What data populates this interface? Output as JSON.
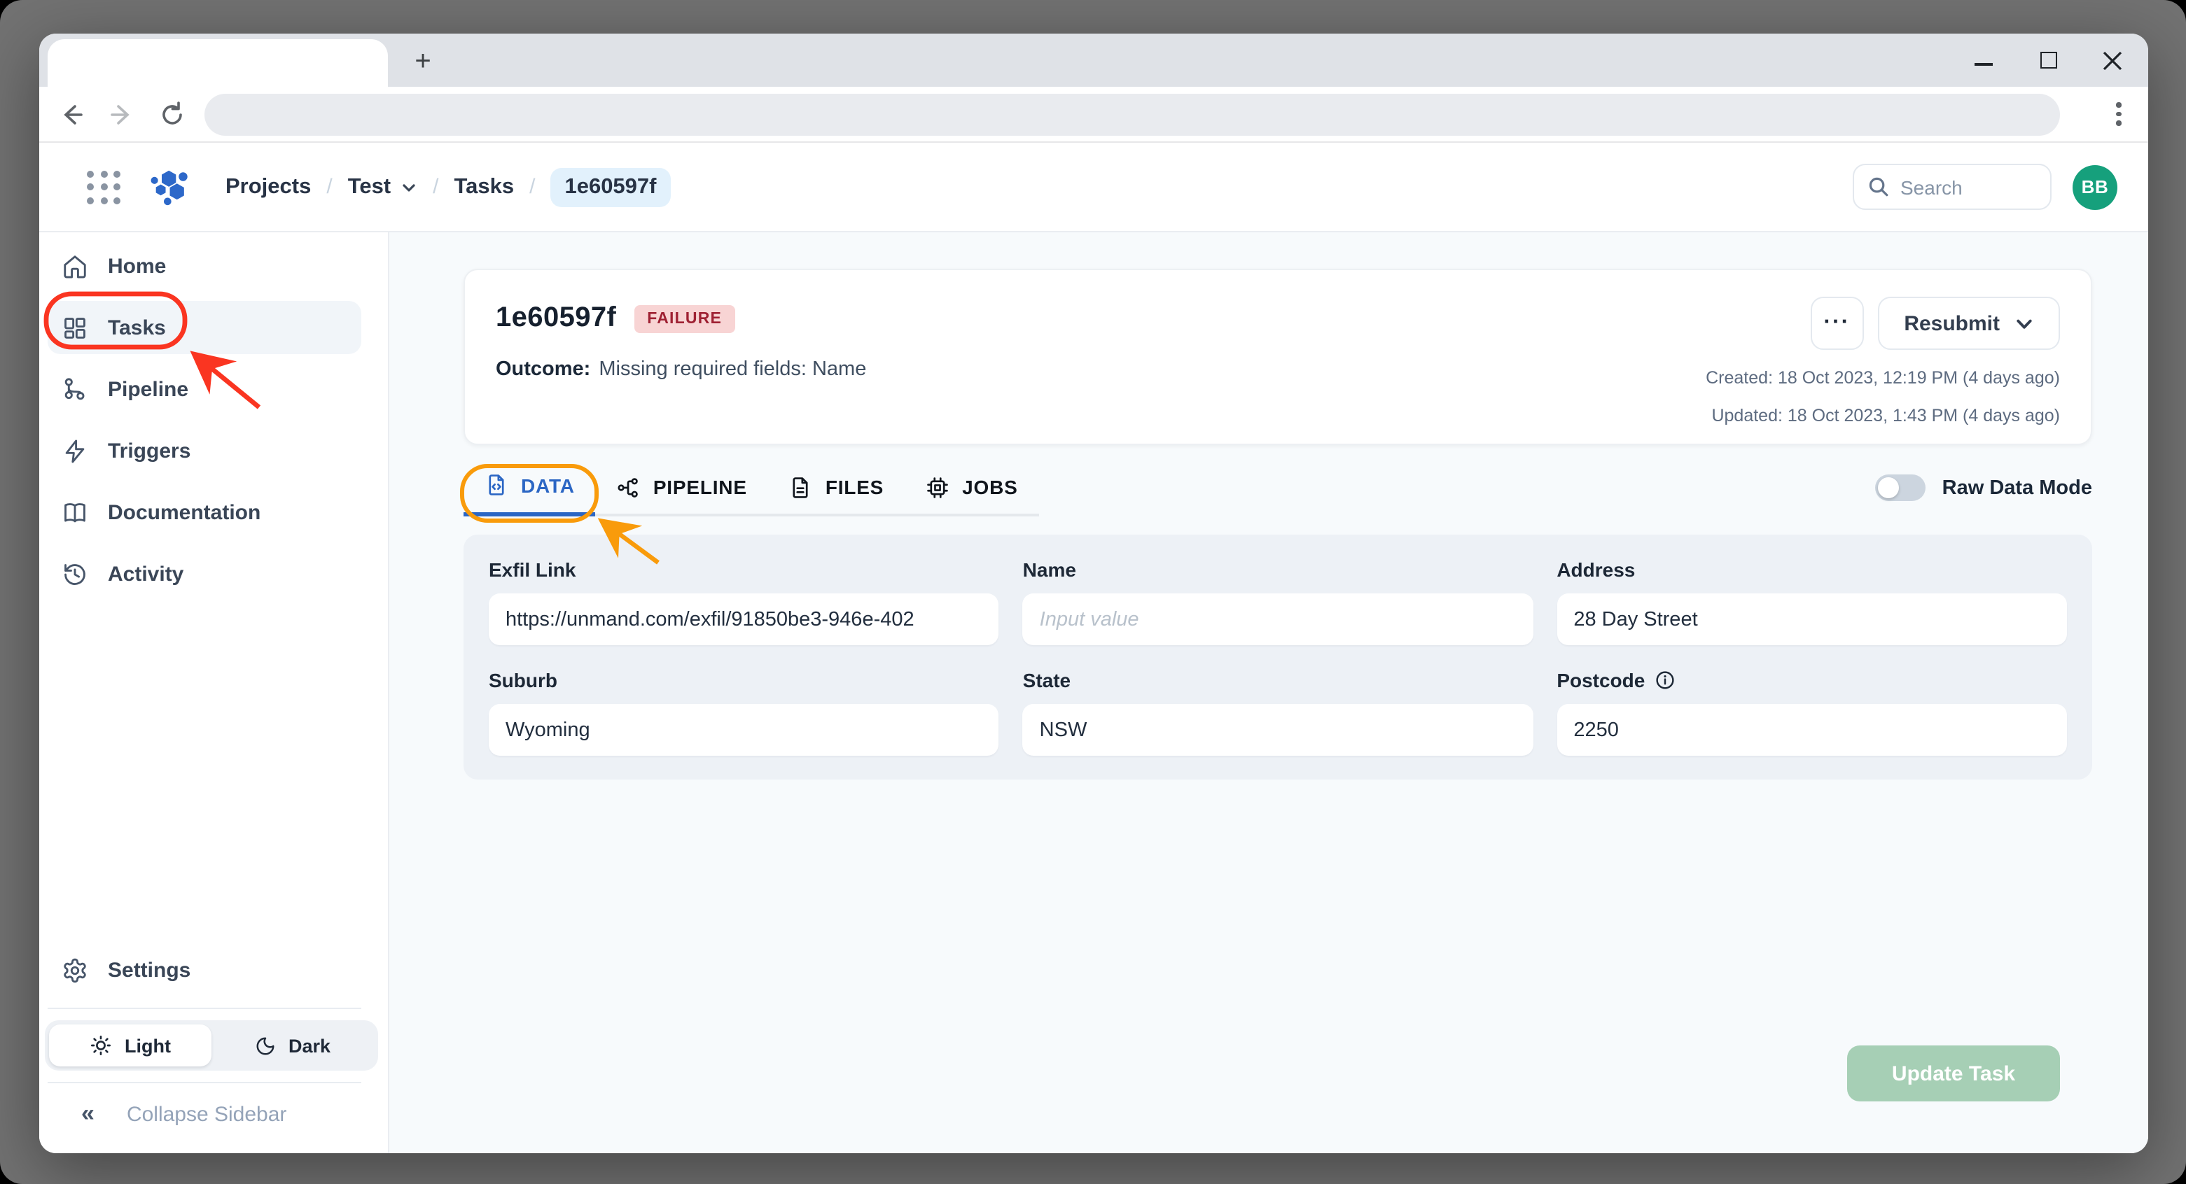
{
  "browser": {
    "new_tab_label": "+",
    "url_value": ""
  },
  "header": {
    "breadcrumbs": {
      "projects": "Projects",
      "project": "Test",
      "section": "Tasks",
      "task_id": "1e60597f"
    },
    "separator": "/",
    "search_placeholder": "Search",
    "avatar_initials": "BB"
  },
  "sidebar": {
    "items": [
      {
        "label": "Home"
      },
      {
        "label": "Tasks",
        "active": true
      },
      {
        "label": "Pipeline"
      },
      {
        "label": "Triggers"
      },
      {
        "label": "Documentation"
      },
      {
        "label": "Activity"
      }
    ],
    "settings_label": "Settings",
    "theme": {
      "light_label": "Light",
      "dark_label": "Dark",
      "selected": "Light"
    },
    "collapse_chevrons": "«",
    "collapse_label": "Collapse Sidebar"
  },
  "task": {
    "id": "1e60597f",
    "status_badge": "FAILURE",
    "outcome_label": "Outcome:",
    "outcome_text": "Missing required fields: Name",
    "more_label": "···",
    "resubmit_label": "Resubmit",
    "created": "Created: 18 Oct 2023, 12:19 PM (4 days ago)",
    "updated": "Updated: 18 Oct 2023, 1:43 PM (4 days ago)"
  },
  "tabs": [
    {
      "label": "DATA",
      "active": true
    },
    {
      "label": "PIPELINE"
    },
    {
      "label": "FILES"
    },
    {
      "label": "JOBS"
    }
  ],
  "raw_data_mode_label": "Raw Data Mode",
  "form": {
    "fields": [
      {
        "label": "Exfil Link",
        "value": "https://unmand.com/exfil/91850be3-946e-402"
      },
      {
        "label": "Name",
        "value": "",
        "placeholder": "Input value"
      },
      {
        "label": "Address",
        "value": "28 Day Street"
      },
      {
        "label": "Suburb",
        "value": "Wyoming"
      },
      {
        "label": "State",
        "value": "NSW"
      },
      {
        "label": "Postcode",
        "value": "2250",
        "has_info_icon": true
      }
    ],
    "update_button_label": "Update Task"
  },
  "colors": {
    "accent_blue": "#2b66c4",
    "failure_bg": "#f8d4d4",
    "failure_text": "#9f2133",
    "avatar_green": "#16a07c",
    "update_button_green": "#a6cfb5",
    "annotation_red": "#fa3521",
    "annotation_orange": "#f99b0b",
    "panel_bg": "#edf1f6",
    "main_bg": "#f7fafc",
    "logo_blue": "#2d68c9"
  }
}
